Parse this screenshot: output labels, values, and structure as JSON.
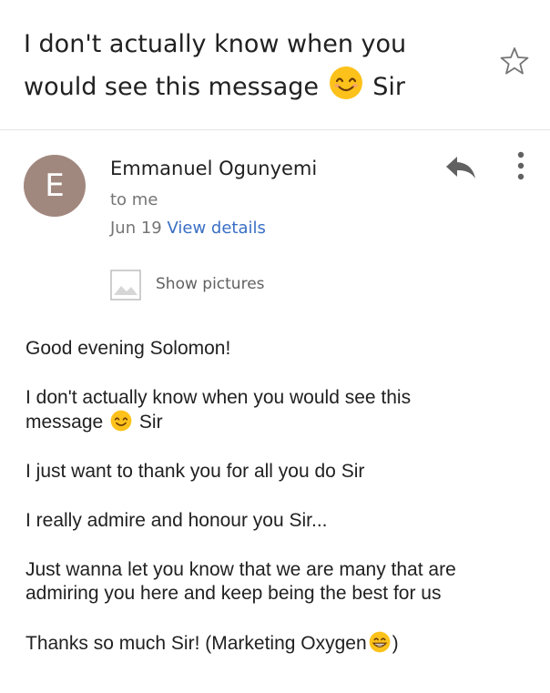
{
  "subject": {
    "line1": "I don't actually know when you",
    "line2": "would see this message",
    "after_emoji": "Sir",
    "emoji_icon": "smiling-face-icon",
    "star_icon": "star-outline-icon"
  },
  "header": {
    "avatar_letter": "E",
    "avatar_color": "#a1887f",
    "sender": "Emmanuel Ogunyemi",
    "recipient": "to me",
    "date": "Jun 19",
    "view_details": "View details",
    "reply_icon": "reply-icon",
    "more_icon": "more-vert-icon"
  },
  "images_prompt": {
    "label": "Show pictures",
    "icon": "image-placeholder-icon"
  },
  "body": {
    "greeting": "Good evening Solomon!",
    "p2_line1": "I don't actually know when you would see this",
    "p2_line2_start": "message",
    "p2_line2_end": "Sir",
    "p3": "I just want to thank you for all you do Sir",
    "p4": "I really admire and honour you Sir...",
    "p5_line1": "Just wanna let you know that we are many that are",
    "p5_line2": "admiring you here and keep being the best for us",
    "p6_start": "Thanks so much Sir! (Marketing Oxygen",
    "p6_end": ")",
    "emoji_grin": "grinning-face-icon"
  },
  "colors": {
    "link": "#3a6fc4",
    "secondary_text": "#757575",
    "emoji_yellow": "#fcc21b"
  }
}
